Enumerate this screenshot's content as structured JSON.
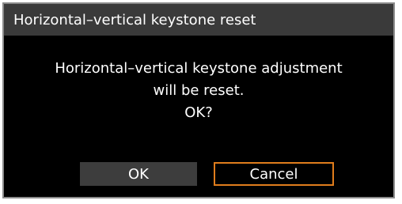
{
  "dialog": {
    "title": "Horizontal–vertical keystone reset",
    "message": {
      "line1": "Horizontal–vertical keystone adjustment",
      "line2": "will be reset.",
      "line3": "OK?"
    },
    "buttons": {
      "ok_label": "OK",
      "cancel_label": "Cancel"
    },
    "focused_button": "Cancel",
    "colors": {
      "titlebar": "#3a3a3a",
      "background": "#000000",
      "focus_border": "#e07d1c",
      "button_fill": "#3d3d3d"
    }
  }
}
